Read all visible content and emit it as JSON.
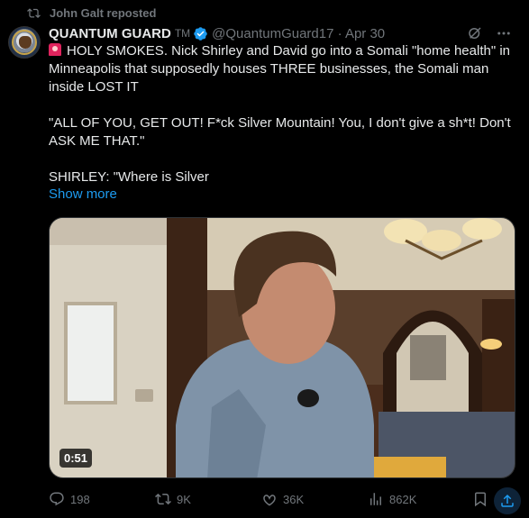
{
  "repost": {
    "text": "John Galt reposted",
    "icon": "repost-icon"
  },
  "author": {
    "display_name": "QUANTUM GUARD",
    "badge_text": "TM",
    "handle_date": "@QuantumGuard17 · Apr 30",
    "verified_color": "#1d9bf0"
  },
  "tweet": {
    "line1": "HOLY SMOKES. Nick Shirley and David go into a Somali \"home health\" in Minneapolis that supposedly houses THREE businesses, the Somali man inside LOST IT",
    "line2": "\"ALL OF YOU, GET OUT! F*ck Silver Mountain! You, I don't give a sh*t! Don't ASK ME THAT.\"",
    "line3": "SHIRLEY: \"Where is Silver",
    "show_more": "Show more"
  },
  "media": {
    "duration": "0:51"
  },
  "actions": {
    "replies": "198",
    "reposts": "9K",
    "likes": "36K",
    "views": "862K"
  },
  "colors": {
    "accent": "#1d9bf0",
    "muted": "#71767b",
    "text": "#e7e9ea",
    "background": "#000000"
  }
}
